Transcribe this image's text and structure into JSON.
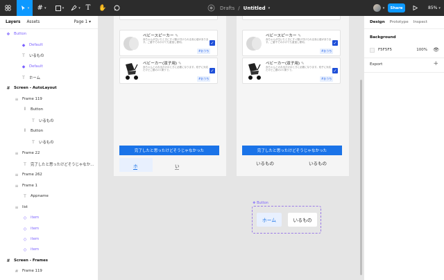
{
  "toolbar": {
    "breadcrumb_drafts": "Drafts",
    "breadcrumb_sep": "/",
    "file_name": "Untitled",
    "share_label": "Share",
    "zoom": "85%"
  },
  "left_panel": {
    "tab_layers": "Layers",
    "tab_assets": "Assets",
    "page_selector": "Page 1",
    "layers": [
      {
        "label": "Button",
        "icon": "component-set-icon",
        "type": "comp"
      },
      {
        "label": "Default",
        "icon": "component-icon",
        "type": "comp"
      },
      {
        "label": "いるもの",
        "icon": "text-icon",
        "type": "normal"
      },
      {
        "label": "Default",
        "icon": "component-icon",
        "type": "comp"
      },
      {
        "label": "ホーム",
        "icon": "text-icon",
        "type": "normal"
      },
      {
        "label": "Screen - AutoLayout",
        "icon": "frame-icon",
        "type": "bold"
      },
      {
        "label": "Frame 119",
        "icon": "autolayout-vertical-icon",
        "type": "normal"
      },
      {
        "label": "Button",
        "icon": "autolayout-horizontal-icon",
        "type": "normal"
      },
      {
        "label": "いるもの",
        "icon": "text-icon",
        "type": "normal"
      },
      {
        "label": "Button",
        "icon": "autolayout-horizontal-icon",
        "type": "normal"
      },
      {
        "label": "いるもの",
        "icon": "text-icon",
        "type": "normal"
      },
      {
        "label": "Frame 22",
        "icon": "autolayout-vertical-icon",
        "type": "normal"
      },
      {
        "label": "完了したと思ったけどそうじゃなか…",
        "icon": "text-icon",
        "type": "normal"
      },
      {
        "label": "Frame 262",
        "icon": "autolayout-vertical-icon",
        "type": "normal"
      },
      {
        "label": "Frame 1",
        "icon": "autolayout-vertical-icon",
        "type": "normal"
      },
      {
        "label": "Appname",
        "icon": "text-icon",
        "type": "normal"
      },
      {
        "label": "list",
        "icon": "autolayout-vertical-icon",
        "type": "normal"
      },
      {
        "label": "item",
        "icon": "instance-icon",
        "type": "comp"
      },
      {
        "label": "item",
        "icon": "instance-icon",
        "type": "comp"
      },
      {
        "label": "item",
        "icon": "instance-icon",
        "type": "comp"
      },
      {
        "label": "item",
        "icon": "instance-icon",
        "type": "comp"
      },
      {
        "label": "Screen - Frames",
        "icon": "frame-icon",
        "type": "bold"
      },
      {
        "label": "Frame 119",
        "icon": "frame-icon",
        "type": "normal"
      }
    ]
  },
  "canvas": {
    "card1": {
      "title": "ベビースピーカー",
      "desc": "赤ちゃんが泣いたときにすぐ駆け付けられる安心感があります。ご廊下でのかけても重宝し便利。",
      "tag": "#おうち"
    },
    "card2": {
      "title": "ベビーカー(双子用)",
      "desc": "赤ちゃんとのお出かけのときに必要になります。双子に対応だけどご廊の2人乗りで。",
      "tag": "#おうち"
    },
    "cta_label": "完了したと思ったけどそうじゃなかった",
    "left_nav": {
      "home": "ホ",
      "items": "い"
    },
    "right_nav": {
      "items1": "いるもの",
      "items2": "いるもの"
    },
    "button_component": {
      "label": "Button",
      "home": "ホーム",
      "items": "いるもの"
    }
  },
  "right_panel": {
    "tab_design": "Design",
    "tab_prototype": "Prototype",
    "tab_inspect": "Inspect",
    "background_title": "Background",
    "background_hex": "F5F5F5",
    "background_opacity": "100%",
    "export_title": "Export"
  },
  "colors": {
    "accent": "#0d99ff",
    "cta": "#1a73e8",
    "component": "#7b61ff",
    "frame_bg": "#F5F5F5"
  }
}
